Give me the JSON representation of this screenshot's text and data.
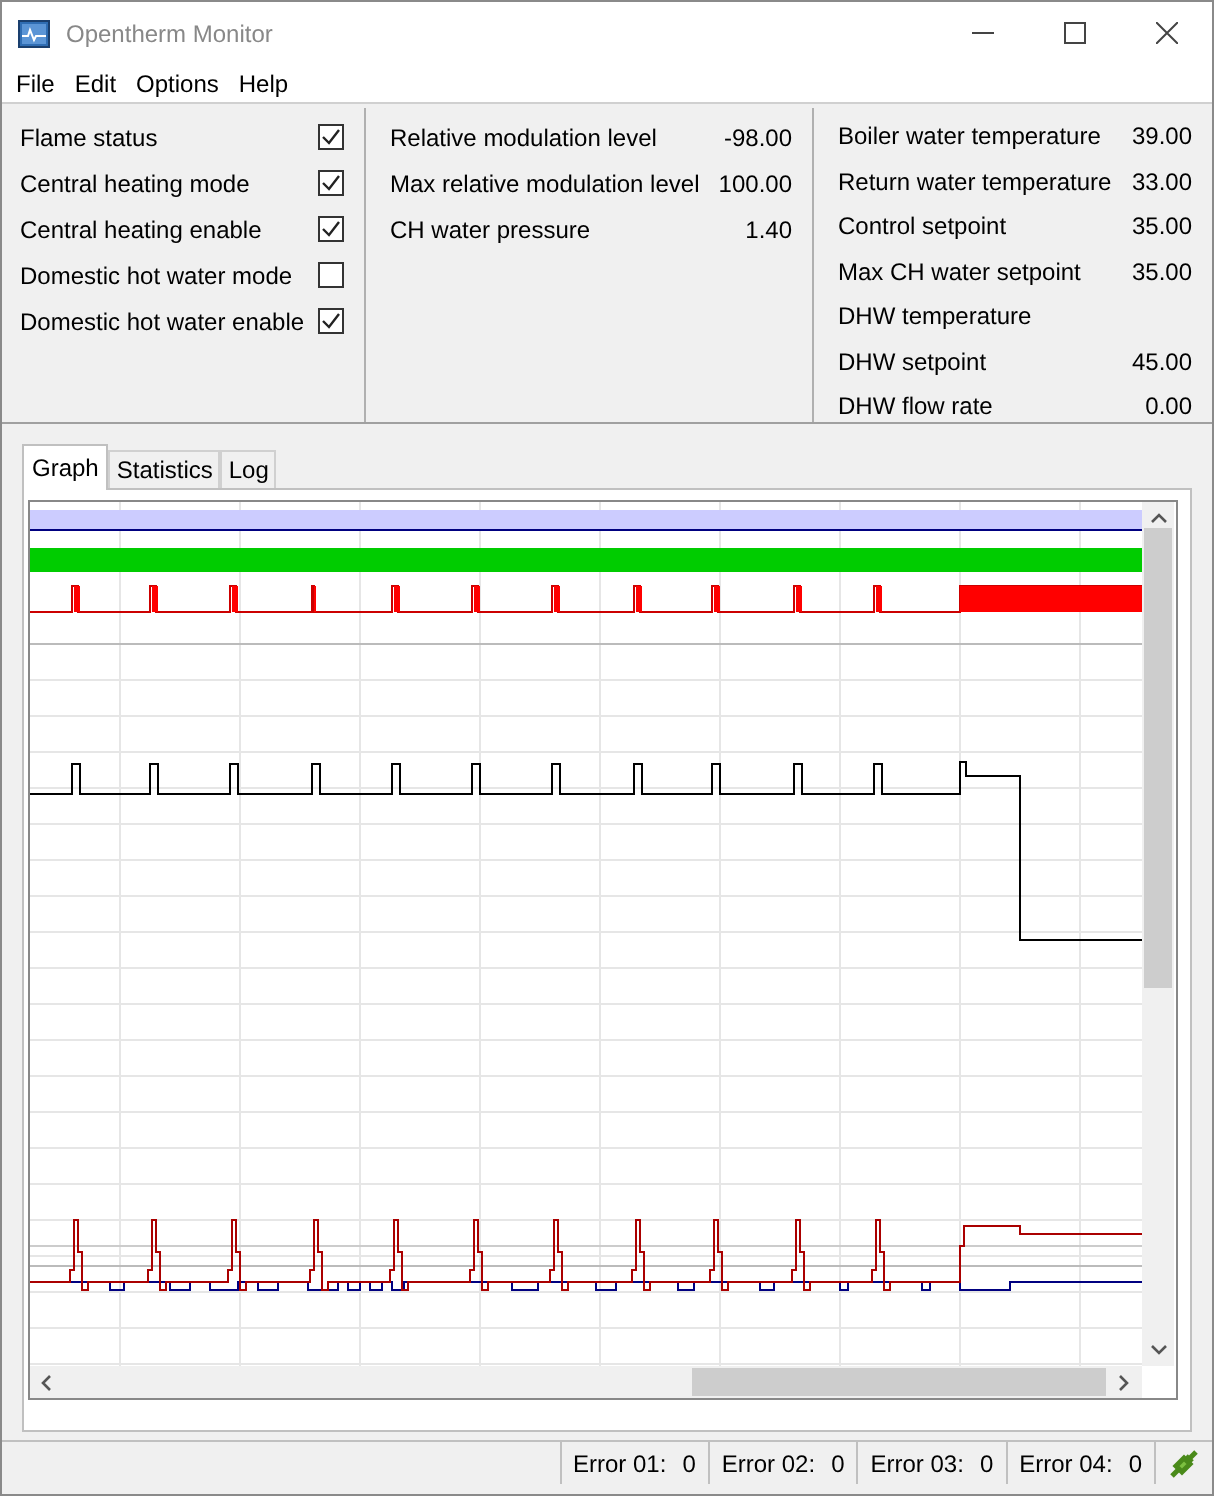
{
  "window": {
    "title": "Opentherm Monitor"
  },
  "menu": [
    "File",
    "Edit",
    "Options",
    "Help"
  ],
  "flags": [
    {
      "label": "Flame status",
      "checked": true
    },
    {
      "label": "Central heating mode",
      "checked": true
    },
    {
      "label": "Central heating enable",
      "checked": true
    },
    {
      "label": "Domestic hot water mode",
      "checked": false
    },
    {
      "label": "Domestic hot water enable",
      "checked": true
    }
  ],
  "modulation": [
    {
      "label": "Relative modulation level",
      "value": "-98.00"
    },
    {
      "label": "Max relative modulation level",
      "value": "100.00"
    },
    {
      "label": "CH water pressure",
      "value": "1.40"
    }
  ],
  "temperatures": [
    {
      "label": "Boiler water temperature",
      "value": "39.00"
    },
    {
      "label": "Return water temperature",
      "value": "33.00"
    },
    {
      "label": "Control setpoint",
      "value": "35.00"
    },
    {
      "label": "Max CH water setpoint",
      "value": "35.00"
    },
    {
      "label": "DHW temperature"
    },
    {
      "label": "DHW setpoint",
      "value": "45.00"
    },
    {
      "label": "DHW flow rate",
      "value": "0.00"
    }
  ],
  "tabs": [
    {
      "label": "Graph",
      "selected": true
    },
    {
      "label": "Statistics",
      "selected": false
    },
    {
      "label": "Log",
      "selected": false
    }
  ],
  "status_bar": [
    {
      "label": "Error 01:",
      "value": "0"
    },
    {
      "label": "Error 02:",
      "value": "0"
    },
    {
      "label": "Error 03:",
      "value": "0"
    },
    {
      "label": "Error 04:",
      "value": "0"
    }
  ]
}
